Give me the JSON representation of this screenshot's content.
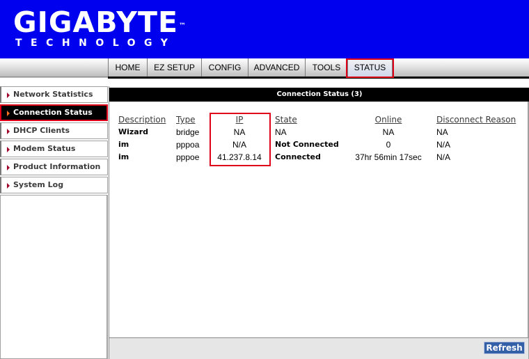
{
  "header": {
    "brand": "GIGABYTE",
    "tm": "™",
    "subtitle": "TECHNOLOGY"
  },
  "nav": {
    "items": [
      "HOME",
      "EZ SETUP",
      "CONFIG",
      "ADVANCED",
      "TOOLS",
      "STATUS"
    ],
    "active": "STATUS"
  },
  "sidebar": {
    "items": [
      "Network Statistics",
      "Connection Status",
      "DHCP Clients",
      "Modem Status",
      "Product Information",
      "System Log"
    ],
    "active": "Connection Status"
  },
  "main": {
    "title": "Connection Status (3)",
    "columns": [
      "Description",
      "Type",
      "IP",
      "State",
      "Online",
      "Disconnect Reason"
    ],
    "rows": [
      [
        "Wizard",
        "bridge",
        "NA",
        "NA",
        "NA",
        "NA"
      ],
      [
        "im",
        "pppoa",
        "N/A",
        "Not Connected",
        "0",
        "N/A"
      ],
      [
        "im",
        "pppoe",
        "41.237.8.14",
        "Connected",
        "37hr 56min 17sec",
        "N/A"
      ]
    ],
    "refresh_label": "Refresh"
  },
  "colors": {
    "header_bg": "#0000ee",
    "highlight": "#e0001a",
    "button": "#3460a8"
  }
}
